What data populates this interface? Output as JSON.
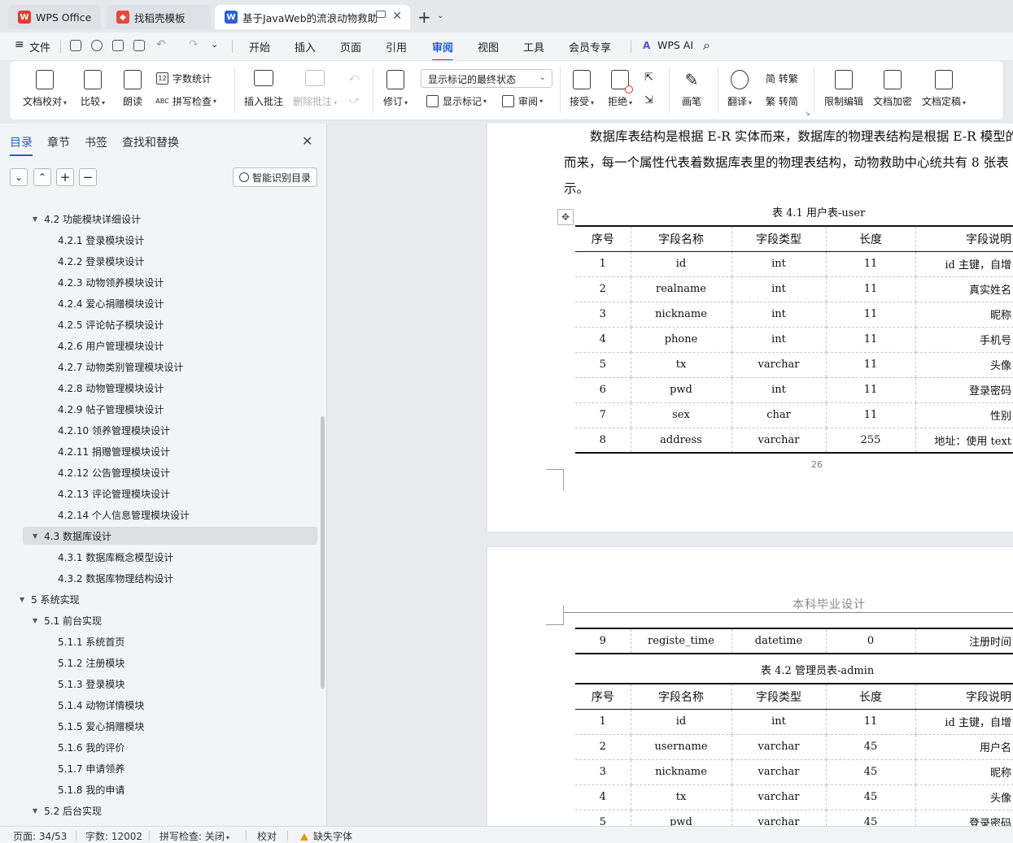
{
  "tabs": [
    {
      "label": "WPS Office",
      "icon": "wps-logo-icon",
      "color": "#e33b2e"
    },
    {
      "label": "找稻壳模板",
      "icon": "docer-icon",
      "color": "#e84a3a"
    },
    {
      "label": "基于JavaWeb的流浪动物救助",
      "icon": "writer-doc-icon",
      "color": "#2b5fd9"
    }
  ],
  "menu": {
    "file": "文件",
    "items": [
      "开始",
      "插入",
      "页面",
      "引用",
      "审阅",
      "视图",
      "工具",
      "会员专享"
    ],
    "active": "审阅",
    "wps_ai": "WPS AI"
  },
  "ribbon": {
    "doc_check": "文档校对",
    "compare": "比较",
    "read_aloud": "朗读",
    "word_count": "字数统计",
    "spell_check": "拼写检查",
    "insert_comment": "插入批注",
    "delete_comment": "删除批注",
    "revise": "修订",
    "markup_state": "显示标记的最终状态",
    "show_markup": "显示标记",
    "review": "审阅",
    "accept": "接受",
    "reject": "拒绝",
    "pen": "画笔",
    "translate": "翻译",
    "to_traditional": "简 转繁",
    "to_simplified": "繁 转简",
    "restrict_edit": "限制编辑",
    "encrypt": "文档加密",
    "finalize": "文档定稿"
  },
  "nav": {
    "tabs": [
      "目录",
      "章节",
      "书签",
      "查找和替换"
    ],
    "active_tab": "目录",
    "smart_toc": "智能识别目录",
    "toc": [
      {
        "text": "4.2  功能模块详细设计",
        "level": 2,
        "expanded": true
      },
      {
        "text": "4.2.1  登录模块设计",
        "level": 3
      },
      {
        "text": "4.2.2  登录模块设计",
        "level": 3
      },
      {
        "text": "4.2.3  动物领养模块设计",
        "level": 3
      },
      {
        "text": "4.2.4 爱心捐赠模块设计",
        "level": 3
      },
      {
        "text": "4.2.5 评论帖子模块设计",
        "level": 3
      },
      {
        "text": "4.2.6 用户管理模块设计",
        "level": 3
      },
      {
        "text": "4.2.7 动物类别管理模块设计",
        "level": 3
      },
      {
        "text": "4.2.8 动物管理模块设计",
        "level": 3
      },
      {
        "text": "4.2.9 帖子管理模块设计",
        "level": 3
      },
      {
        "text": "4.2.10 领养管理模块设计",
        "level": 3
      },
      {
        "text": "4.2.11 捐赠管理模块设计",
        "level": 3
      },
      {
        "text": "4.2.12 公告管理模块设计",
        "level": 3
      },
      {
        "text": "4.2.13 评论管理模块设计",
        "level": 3
      },
      {
        "text": "4.2.14 个人信息管理模块设计",
        "level": 3
      },
      {
        "text": "4.3  数据库设计",
        "level": 2,
        "expanded": true,
        "selected": true
      },
      {
        "text": "4.3.1 数据库概念模型设计",
        "level": 3
      },
      {
        "text": "4.3.2 数据库物理结构设计",
        "level": 3
      },
      {
        "text": "5  系统实现",
        "level": 1,
        "expanded": true
      },
      {
        "text": "5.1  前台实现",
        "level": 2,
        "expanded": true
      },
      {
        "text": "5.1.1  系统首页",
        "level": 3
      },
      {
        "text": "5.1.2  注册模块",
        "level": 3
      },
      {
        "text": "5.1.3 登录模块",
        "level": 3
      },
      {
        "text": "5.1.4 动物详情模块",
        "level": 3
      },
      {
        "text": "5.1.5 爱心捐赠模块",
        "level": 3
      },
      {
        "text": "5.1.6  我的评价",
        "level": 3
      },
      {
        "text": "5.1.7  申请领养",
        "level": 3
      },
      {
        "text": "5.1.8  我的申请",
        "level": 3
      },
      {
        "text": "5.2  后台实现",
        "level": 2,
        "expanded": true
      }
    ]
  },
  "doc": {
    "para_lines": [
      "数据库表结构是根据 E-R 实体而来，数据库的物理表结构是根据 E-R 模型的",
      "而来，每一个属性代表着数据库表里的物理表结构，动物救助中心统共有 8 张表",
      "示。"
    ],
    "table1_caption": "表 4.1 用户表-user",
    "columns": [
      "序号",
      "字段名称",
      "字段类型",
      "长度",
      "字段说明"
    ],
    "table1_rows": [
      [
        "1",
        "id",
        "int",
        "11",
        "id 主键，自增"
      ],
      [
        "2",
        "realname",
        "int",
        "11",
        "真实姓名"
      ],
      [
        "3",
        "nickname",
        "int",
        "11",
        "昵称"
      ],
      [
        "4",
        "phone",
        "int",
        "11",
        "手机号"
      ],
      [
        "5",
        "tx",
        "varchar",
        "11",
        "头像"
      ],
      [
        "6",
        "pwd",
        "int",
        "11",
        "登录密码"
      ],
      [
        "7",
        "sex",
        "char",
        "11",
        "性别"
      ],
      [
        "8",
        "address",
        "varchar",
        "255",
        "地址：使用 text"
      ]
    ],
    "page_number": "26",
    "page2_header": "本科毕业设计",
    "table1_cont_rows": [
      [
        "9",
        "registe_time",
        "datetime",
        "0",
        "注册时间"
      ]
    ],
    "table2_caption": "表 4.2 管理员表-admin",
    "table2_rows": [
      [
        "1",
        "id",
        "int",
        "11",
        "id 主键，自增"
      ],
      [
        "2",
        "username",
        "varchar",
        "45",
        "用户名"
      ],
      [
        "3",
        "nickname",
        "varchar",
        "45",
        "昵称"
      ],
      [
        "4",
        "tx",
        "varchar",
        "45",
        "头像"
      ],
      [
        "5",
        "pwd",
        "varchar",
        "45",
        "登录密码"
      ]
    ]
  },
  "status": {
    "page": "页面: 34/53",
    "words": "字数: 12002",
    "spell": "拼写检查: 关闭",
    "proof": "校对",
    "missing_font": "缺失字体"
  },
  "colors": {
    "accent": "#1a5fdb",
    "warning": "#e59a00"
  }
}
